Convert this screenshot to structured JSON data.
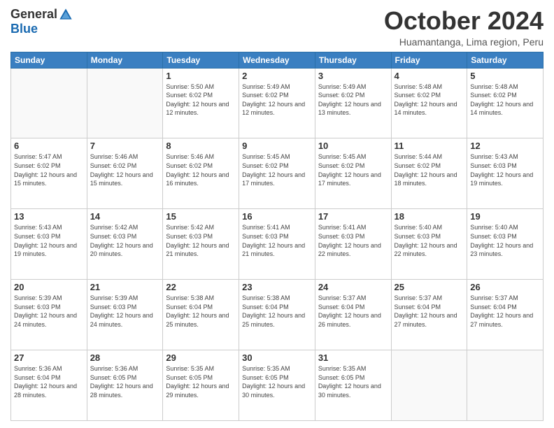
{
  "header": {
    "logo_general": "General",
    "logo_blue": "Blue",
    "month_title": "October 2024",
    "subtitle": "Huamantanga, Lima region, Peru"
  },
  "weekdays": [
    "Sunday",
    "Monday",
    "Tuesday",
    "Wednesday",
    "Thursday",
    "Friday",
    "Saturday"
  ],
  "weeks": [
    [
      {
        "day": "",
        "info": ""
      },
      {
        "day": "",
        "info": ""
      },
      {
        "day": "1",
        "info": "Sunrise: 5:50 AM\nSunset: 6:02 PM\nDaylight: 12 hours and 12 minutes."
      },
      {
        "day": "2",
        "info": "Sunrise: 5:49 AM\nSunset: 6:02 PM\nDaylight: 12 hours and 12 minutes."
      },
      {
        "day": "3",
        "info": "Sunrise: 5:49 AM\nSunset: 6:02 PM\nDaylight: 12 hours and 13 minutes."
      },
      {
        "day": "4",
        "info": "Sunrise: 5:48 AM\nSunset: 6:02 PM\nDaylight: 12 hours and 14 minutes."
      },
      {
        "day": "5",
        "info": "Sunrise: 5:48 AM\nSunset: 6:02 PM\nDaylight: 12 hours and 14 minutes."
      }
    ],
    [
      {
        "day": "6",
        "info": "Sunrise: 5:47 AM\nSunset: 6:02 PM\nDaylight: 12 hours and 15 minutes."
      },
      {
        "day": "7",
        "info": "Sunrise: 5:46 AM\nSunset: 6:02 PM\nDaylight: 12 hours and 15 minutes."
      },
      {
        "day": "8",
        "info": "Sunrise: 5:46 AM\nSunset: 6:02 PM\nDaylight: 12 hours and 16 minutes."
      },
      {
        "day": "9",
        "info": "Sunrise: 5:45 AM\nSunset: 6:02 PM\nDaylight: 12 hours and 17 minutes."
      },
      {
        "day": "10",
        "info": "Sunrise: 5:45 AM\nSunset: 6:02 PM\nDaylight: 12 hours and 17 minutes."
      },
      {
        "day": "11",
        "info": "Sunrise: 5:44 AM\nSunset: 6:02 PM\nDaylight: 12 hours and 18 minutes."
      },
      {
        "day": "12",
        "info": "Sunrise: 5:43 AM\nSunset: 6:03 PM\nDaylight: 12 hours and 19 minutes."
      }
    ],
    [
      {
        "day": "13",
        "info": "Sunrise: 5:43 AM\nSunset: 6:03 PM\nDaylight: 12 hours and 19 minutes."
      },
      {
        "day": "14",
        "info": "Sunrise: 5:42 AM\nSunset: 6:03 PM\nDaylight: 12 hours and 20 minutes."
      },
      {
        "day": "15",
        "info": "Sunrise: 5:42 AM\nSunset: 6:03 PM\nDaylight: 12 hours and 21 minutes."
      },
      {
        "day": "16",
        "info": "Sunrise: 5:41 AM\nSunset: 6:03 PM\nDaylight: 12 hours and 21 minutes."
      },
      {
        "day": "17",
        "info": "Sunrise: 5:41 AM\nSunset: 6:03 PM\nDaylight: 12 hours and 22 minutes."
      },
      {
        "day": "18",
        "info": "Sunrise: 5:40 AM\nSunset: 6:03 PM\nDaylight: 12 hours and 22 minutes."
      },
      {
        "day": "19",
        "info": "Sunrise: 5:40 AM\nSunset: 6:03 PM\nDaylight: 12 hours and 23 minutes."
      }
    ],
    [
      {
        "day": "20",
        "info": "Sunrise: 5:39 AM\nSunset: 6:03 PM\nDaylight: 12 hours and 24 minutes."
      },
      {
        "day": "21",
        "info": "Sunrise: 5:39 AM\nSunset: 6:03 PM\nDaylight: 12 hours and 24 minutes."
      },
      {
        "day": "22",
        "info": "Sunrise: 5:38 AM\nSunset: 6:04 PM\nDaylight: 12 hours and 25 minutes."
      },
      {
        "day": "23",
        "info": "Sunrise: 5:38 AM\nSunset: 6:04 PM\nDaylight: 12 hours and 25 minutes."
      },
      {
        "day": "24",
        "info": "Sunrise: 5:37 AM\nSunset: 6:04 PM\nDaylight: 12 hours and 26 minutes."
      },
      {
        "day": "25",
        "info": "Sunrise: 5:37 AM\nSunset: 6:04 PM\nDaylight: 12 hours and 27 minutes."
      },
      {
        "day": "26",
        "info": "Sunrise: 5:37 AM\nSunset: 6:04 PM\nDaylight: 12 hours and 27 minutes."
      }
    ],
    [
      {
        "day": "27",
        "info": "Sunrise: 5:36 AM\nSunset: 6:04 PM\nDaylight: 12 hours and 28 minutes."
      },
      {
        "day": "28",
        "info": "Sunrise: 5:36 AM\nSunset: 6:05 PM\nDaylight: 12 hours and 28 minutes."
      },
      {
        "day": "29",
        "info": "Sunrise: 5:35 AM\nSunset: 6:05 PM\nDaylight: 12 hours and 29 minutes."
      },
      {
        "day": "30",
        "info": "Sunrise: 5:35 AM\nSunset: 6:05 PM\nDaylight: 12 hours and 30 minutes."
      },
      {
        "day": "31",
        "info": "Sunrise: 5:35 AM\nSunset: 6:05 PM\nDaylight: 12 hours and 30 minutes."
      },
      {
        "day": "",
        "info": ""
      },
      {
        "day": "",
        "info": ""
      }
    ]
  ]
}
